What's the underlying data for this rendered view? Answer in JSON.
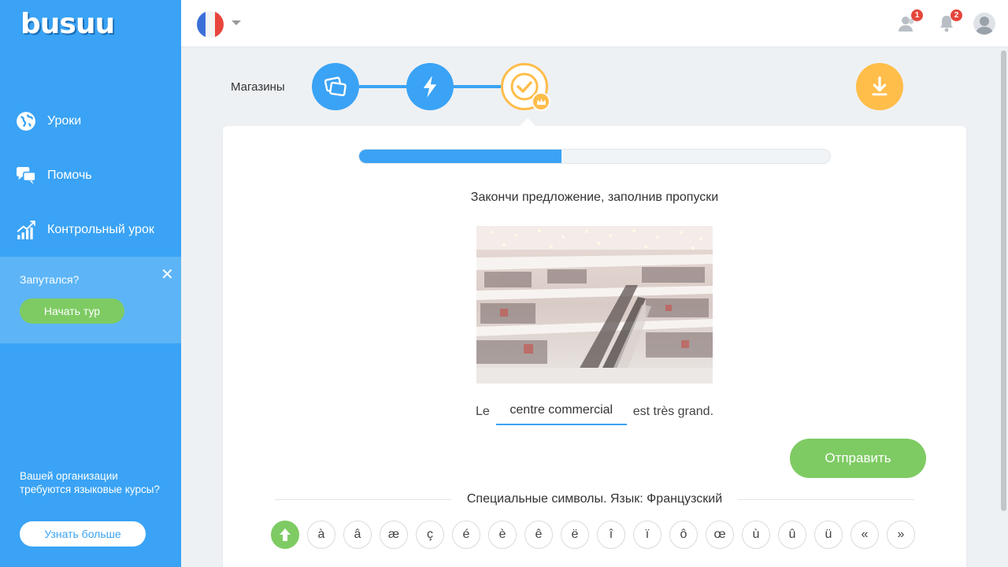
{
  "brand": {
    "logo": "busuu"
  },
  "sidebar": {
    "items": [
      {
        "label": "Уроки",
        "icon": "globe-icon"
      },
      {
        "label": "Помочь",
        "icon": "chat-icon"
      },
      {
        "label": "Контрольный урок",
        "icon": "bar-chart-icon"
      }
    ],
    "tour": {
      "question": "Запутался?",
      "button": "Начать тур"
    },
    "org": {
      "text": "Вашей организации требуются языковые курсы?",
      "button": "Узнать больше"
    }
  },
  "topbar": {
    "language_flag": "france-flag-icon",
    "friends_badge": "1",
    "notifications_badge": "2"
  },
  "lesson": {
    "title": "Магазины",
    "progress": 0.43
  },
  "exercise": {
    "instruction": "Закончи предложение, заполнив пропуски",
    "sentence_before": "Le",
    "answer": "centre commercial",
    "sentence_after": "est très grand.",
    "submit": "Отправить"
  },
  "special": {
    "title": "Специальные символы. Язык: Французский",
    "chars": [
      "à",
      "â",
      "æ",
      "ç",
      "é",
      "è",
      "ê",
      "ë",
      "î",
      "ï",
      "ô",
      "œ",
      "ù",
      "û",
      "ü",
      "«",
      "»"
    ]
  },
  "colors": {
    "primary": "#3aa3f5",
    "accent": "#ffbd4a",
    "success": "#7ecb63",
    "badge": "#e4463c"
  }
}
